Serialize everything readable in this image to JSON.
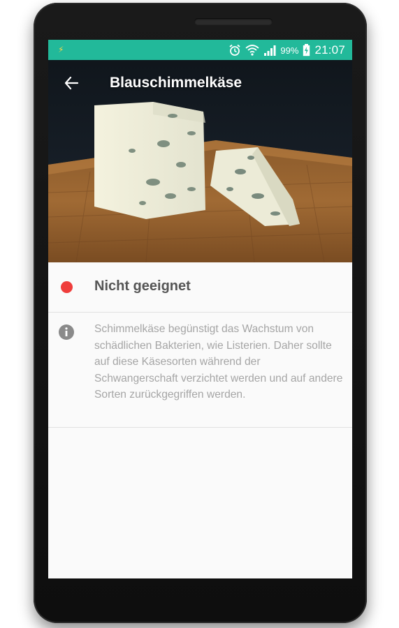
{
  "status_bar": {
    "notification_icon": "flash-icon",
    "alarm_icon": "alarm-clock-icon",
    "wifi_icon": "wifi-icon",
    "signal_icon": "signal-bars-icon",
    "battery_percent": "99%",
    "battery_icon": "battery-charging-icon",
    "time": "21:07",
    "color": "#22b99a"
  },
  "header": {
    "back_icon": "arrow-left-icon",
    "title": "Blauschimmelkäse",
    "image": "blue-cheese-photo"
  },
  "rating": {
    "status_color": "#ef3d3b",
    "label": "Nicht geeignet"
  },
  "info": {
    "icon": "info-icon",
    "text": "Schimmelkäse begünstigt das Wachstum von schädlichen Bakterien, wie Listerien. Daher sollte auf diese Käsesorten während der Schwangerschaft verzichtet werden und auf andere Sorten zurückgegriffen werden."
  }
}
